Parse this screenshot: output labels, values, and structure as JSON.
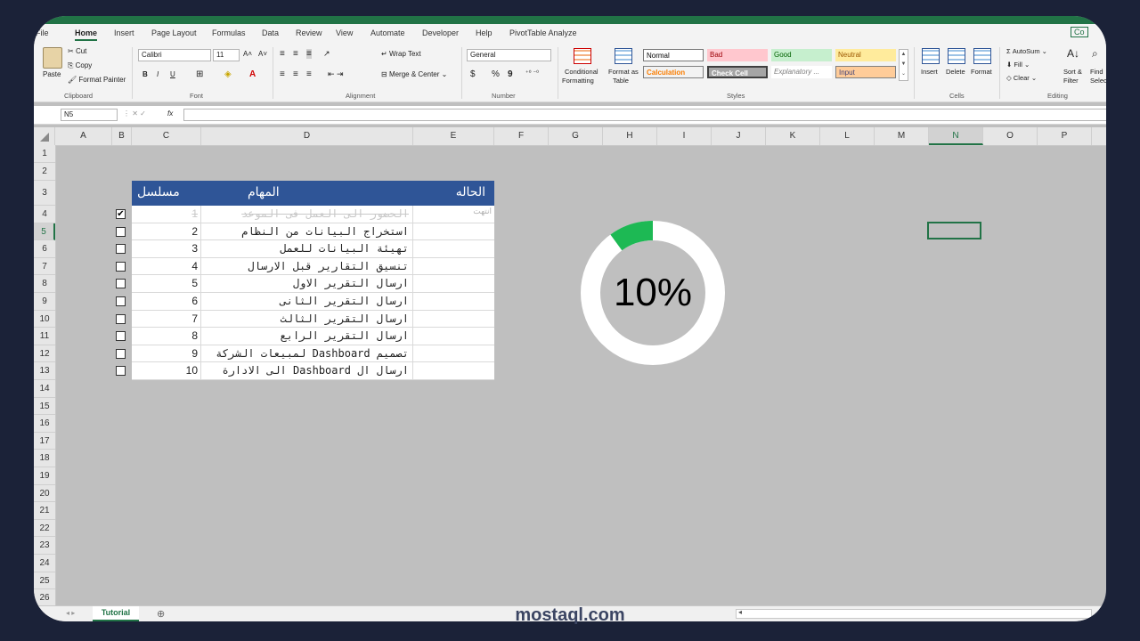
{
  "menu": {
    "tabs": [
      "File",
      "Home",
      "Insert",
      "Page Layout",
      "Formulas",
      "Data",
      "Review",
      "View",
      "Automate",
      "Developer",
      "Help",
      "PivotTable Analyze"
    ],
    "active": "Home",
    "comments": "Co"
  },
  "ribbon": {
    "clipboard": {
      "paste": "Paste",
      "cut": "Cut",
      "copy": "Copy",
      "format_painter": "Format Painter",
      "label": "Clipboard"
    },
    "font": {
      "name": "Calibri",
      "size": "11",
      "bold": "B",
      "italic": "I",
      "underline": "U",
      "grow": "A˄",
      "shrink": "A˅",
      "label": "Font"
    },
    "alignment": {
      "wrap_text": "Wrap Text",
      "merge_center": "Merge & Center",
      "label": "Alignment"
    },
    "number": {
      "format": "General",
      "currency": "$",
      "percent": "%",
      "comma": "9",
      "label": "Number"
    },
    "styles": {
      "conditional": "Conditional",
      "conditional2": "Formatting",
      "format_as": "Format as",
      "format_as2": "Table",
      "cells": [
        {
          "label": "Normal",
          "bg": "#ffffff",
          "fg": "#000000"
        },
        {
          "label": "Bad",
          "bg": "#ffc7ce",
          "fg": "#9c0006"
        },
        {
          "label": "Good",
          "bg": "#c6efce",
          "fg": "#006100"
        },
        {
          "label": "Neutral",
          "bg": "#ffeb9c",
          "fg": "#9c5700"
        },
        {
          "label": "Calculation",
          "bg": "#f2f2f2",
          "fg": "#fa7d00"
        },
        {
          "label": "Check Cell",
          "bg": "#a5a5a5",
          "fg": "#ffffff"
        },
        {
          "label": "Explanatory ...",
          "bg": "#ffffff",
          "fg": "#7f7f7f"
        },
        {
          "label": "Input",
          "bg": "#ffcc99",
          "fg": "#3f3f76"
        }
      ],
      "label": "Styles"
    },
    "cells": {
      "insert": "Insert",
      "delete": "Delete",
      "format": "Format",
      "label": "Cells"
    },
    "editing": {
      "autosum": "AutoSum",
      "fill": "Fill",
      "clear": "Clear",
      "sort": "Sort &",
      "sort2": "Filter",
      "find": "Find",
      "find2": "Select",
      "label": "Editing"
    }
  },
  "formula_bar": {
    "name_box": "N5",
    "fx": "fx",
    "value": ""
  },
  "columns": [
    "A",
    "B",
    "C",
    "D",
    "E",
    "F",
    "G",
    "H",
    "I",
    "J",
    "K",
    "L",
    "M",
    "N",
    "O",
    "P"
  ],
  "selected_column": "N",
  "rows": [
    "1",
    "2",
    "3",
    "4",
    "5",
    "6",
    "7",
    "8",
    "9",
    "10",
    "11",
    "12",
    "13",
    "14",
    "15",
    "16",
    "17",
    "18",
    "19",
    "20",
    "21",
    "22",
    "23",
    "24",
    "25",
    "26"
  ],
  "selected_row": "5",
  "table": {
    "header": {
      "serial": "مسلسل",
      "task": "المهام",
      "status": "الحاله"
    },
    "rows": [
      {
        "checked": true,
        "check_mark": "✔",
        "serial": "1",
        "task": "الحضور الى العمل فى الموعد",
        "status": "انتهت"
      },
      {
        "checked": false,
        "serial": "2",
        "task": "استخراج البيانات من النظام",
        "status": ""
      },
      {
        "checked": false,
        "serial": "3",
        "task": "تهيئة البيانات للعمل",
        "status": ""
      },
      {
        "checked": false,
        "serial": "4",
        "task": "تنسيق التقارير قبل الارسال",
        "status": ""
      },
      {
        "checked": false,
        "serial": "5",
        "task": "ارسال التقرير الاول",
        "status": ""
      },
      {
        "checked": false,
        "serial": "6",
        "task": "ارسال التقرير الثانى",
        "status": ""
      },
      {
        "checked": false,
        "serial": "7",
        "task": "ارسال التقرير الثالث",
        "status": ""
      },
      {
        "checked": false,
        "serial": "8",
        "task": "ارسال التقرير الرابع",
        "status": ""
      },
      {
        "checked": false,
        "serial": "9",
        "task": "تصميم Dashboard لمبيعات الشركة",
        "status": ""
      },
      {
        "checked": false,
        "serial": "10",
        "task": "ارسال ال Dashboard الى الادارة",
        "status": ""
      }
    ]
  },
  "progress": {
    "label": "10%",
    "fraction": 0.1,
    "fill_color": "#1db954",
    "track_color": "#ffffff",
    "center_color": "#bfbfbf"
  },
  "sheet": {
    "tab": "Tutorial",
    "add": "⊕"
  },
  "watermark": "mostaql.com",
  "colors": {
    "excel_green": "#217346",
    "table_header": "#2f5597",
    "grid_bg": "#bfbfbf"
  }
}
